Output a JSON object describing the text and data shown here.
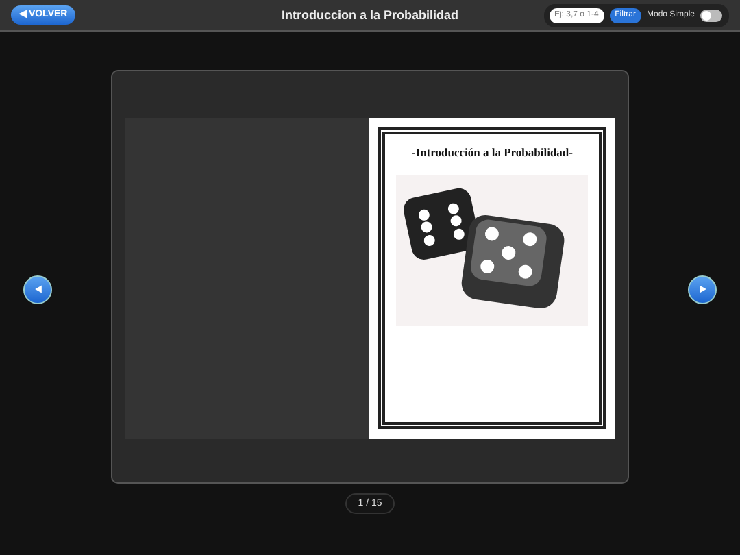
{
  "top_bar": {
    "back_button": "◀ VOLVER",
    "title": "Introduccion a la Probabilidad",
    "page_filter": {
      "placeholder": "Ej: 3,7 o 1-4"
    },
    "filter_button": "Filtrar",
    "simple_mode": {
      "label": "Modo Simple",
      "on": false
    }
  },
  "viewer": {
    "cover_title": "-Introducción a la Probabilidad-",
    "page_counter": "1 / 15"
  }
}
